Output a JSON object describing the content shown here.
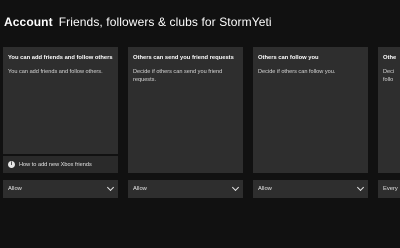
{
  "header": {
    "section": "Account",
    "title": "Friends, followers & clubs for StormYeti"
  },
  "panels": [
    {
      "title": "You can add friends and follow others",
      "description": "You can add friends and follow others.",
      "help_link": "How to add new Xbox friends",
      "dropdown_value": "Allow"
    },
    {
      "title": "Others can send you friend requests",
      "description": "Decide if others can send you friend requests.",
      "dropdown_value": "Allow"
    },
    {
      "title": "Others can follow you",
      "description": "Decide if others can follow you.",
      "dropdown_value": "Allow"
    },
    {
      "title": "Othe",
      "description": "Deci\nfollo",
      "dropdown_value": "Every"
    }
  ],
  "icons": {
    "info": "info-icon",
    "dropdown": "chevron-down-icon"
  }
}
